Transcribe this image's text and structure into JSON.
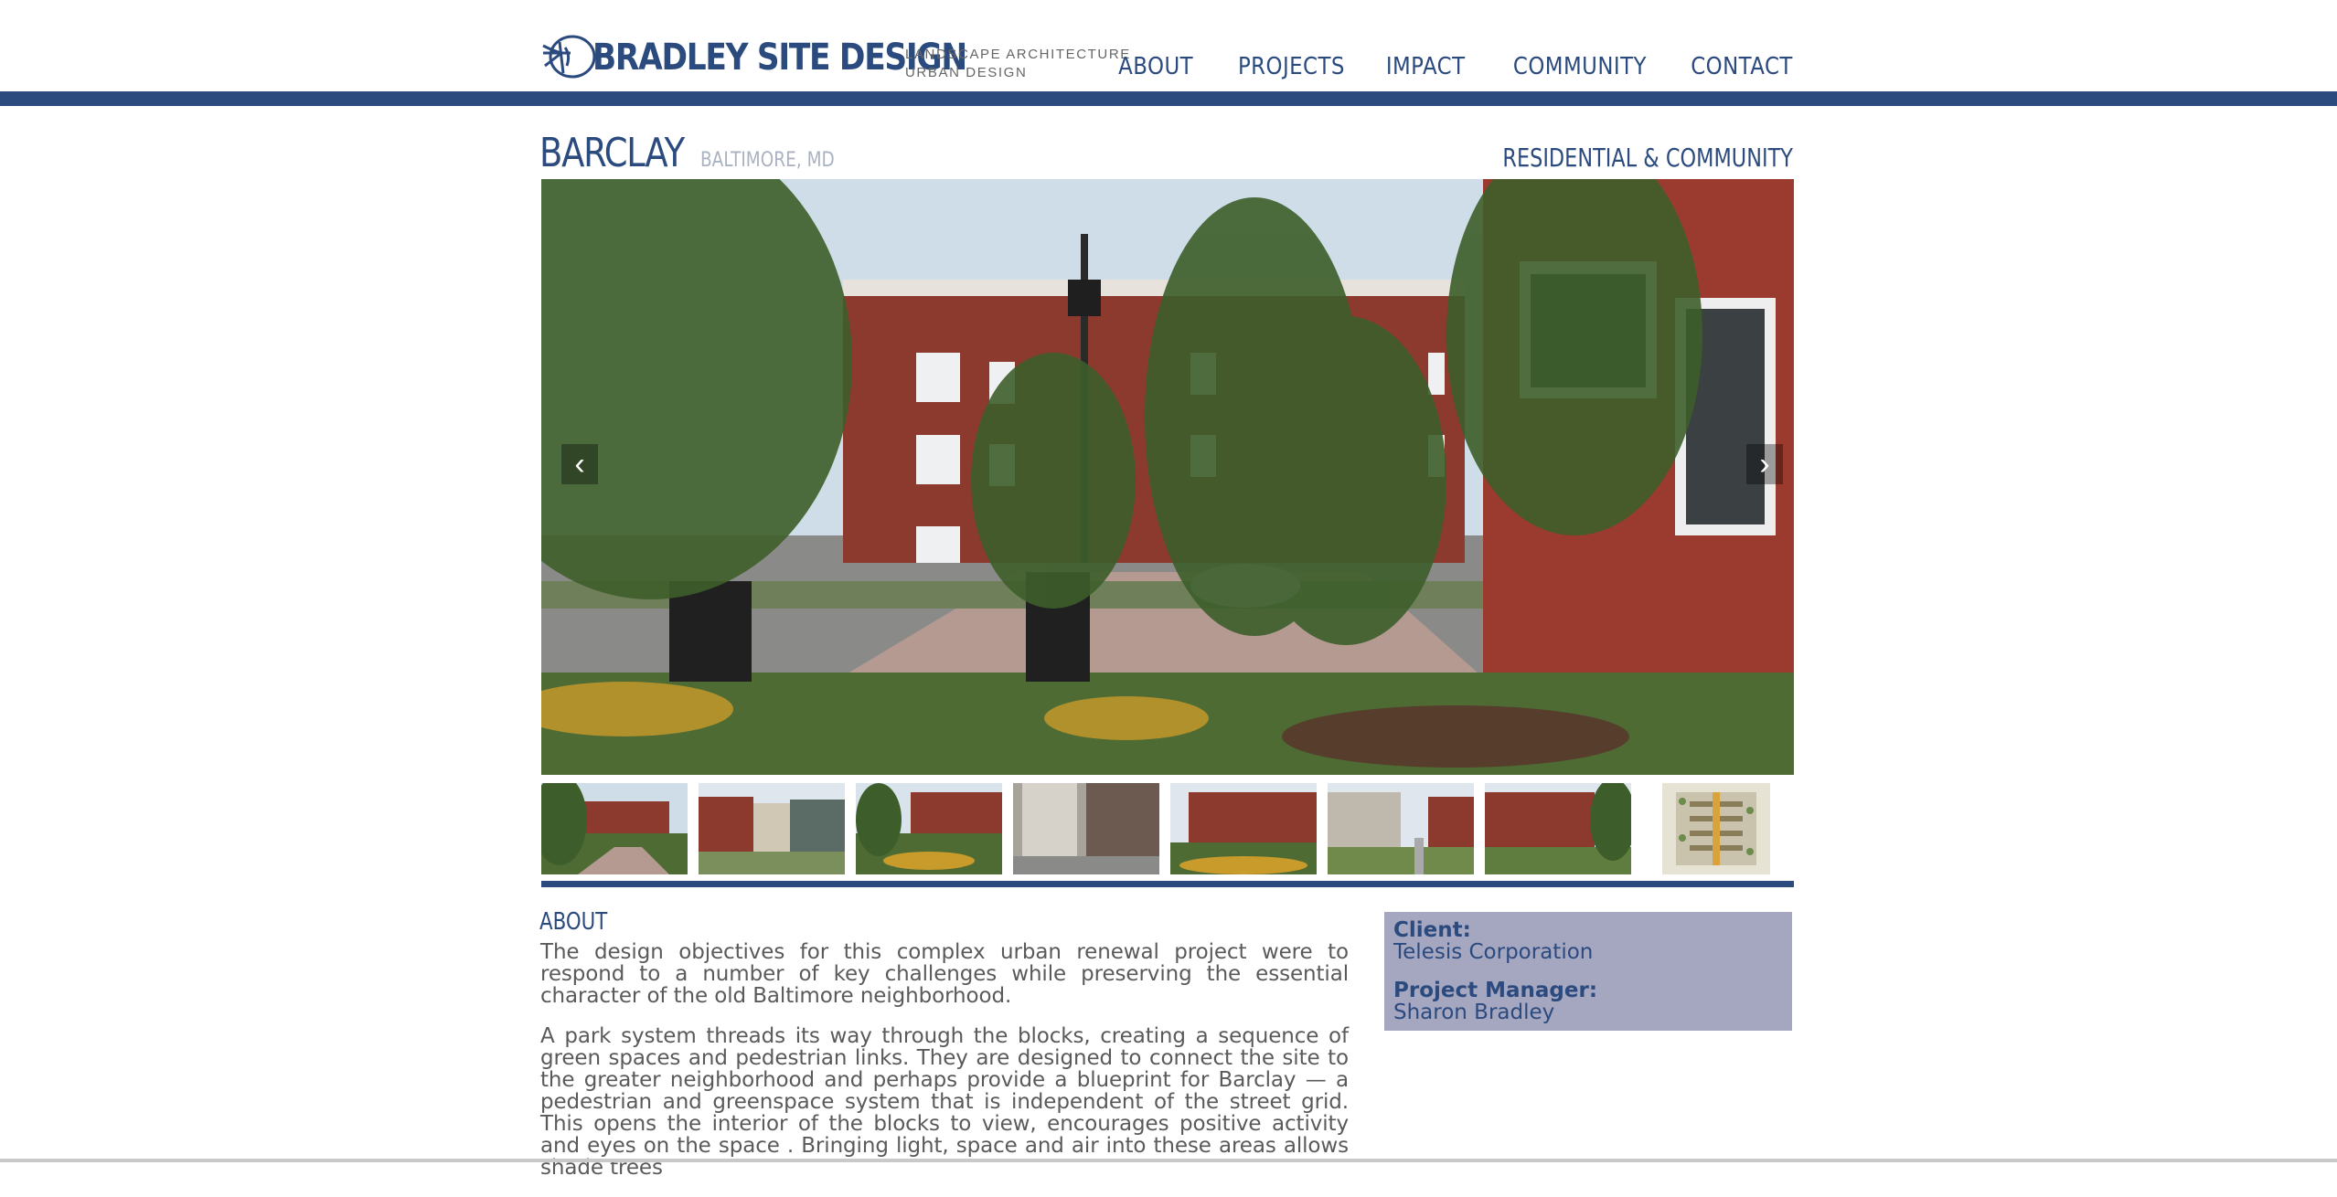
{
  "brand": {
    "name": "BRADLEY SITE DESIGN",
    "tagline_line1": "LANDSCAPE ARCHITECTURE",
    "tagline_line2": "URBAN DESIGN",
    "logo_icon": "dragonfly-icon",
    "color": "#2b4a7e"
  },
  "nav": {
    "items": [
      "ABOUT",
      "PROJECTS",
      "IMPACT",
      "COMMUNITY",
      "CONTACT"
    ]
  },
  "project": {
    "name": "BARCLAY",
    "location": "BALTIMORE, MD",
    "category": "RESIDENTIAL & COMMUNITY"
  },
  "gallery": {
    "prev_icon": "chevron-left-icon",
    "prev_label": "‹",
    "next_icon": "chevron-right-icon",
    "next_label": "›",
    "thumbnail_count": 8
  },
  "about": {
    "heading": "ABOUT",
    "paragraphs": [
      "The design objectives for this complex urban renewal project were to respond to a number of key challenges while preserving the essential character of the old Baltimore neighborhood.",
      "A park system threads its way through the blocks, creating a sequence of green spaces and pedestrian links. They are designed to connect the site to the greater neighborhood and perhaps provide a blueprint for Barclay — a pedestrian and greenspace system that is independent of the street grid. This opens the interior of the blocks to view, encourages positive activity and eyes on the space . Bringing light, space and air into these areas allows shade trees"
    ]
  },
  "info": {
    "client_label": "Client:",
    "client_value": "Telesis Corporation",
    "pm_label": "Project Manager:",
    "pm_value": "Sharon Bradley",
    "background": "#a5a6c0"
  }
}
